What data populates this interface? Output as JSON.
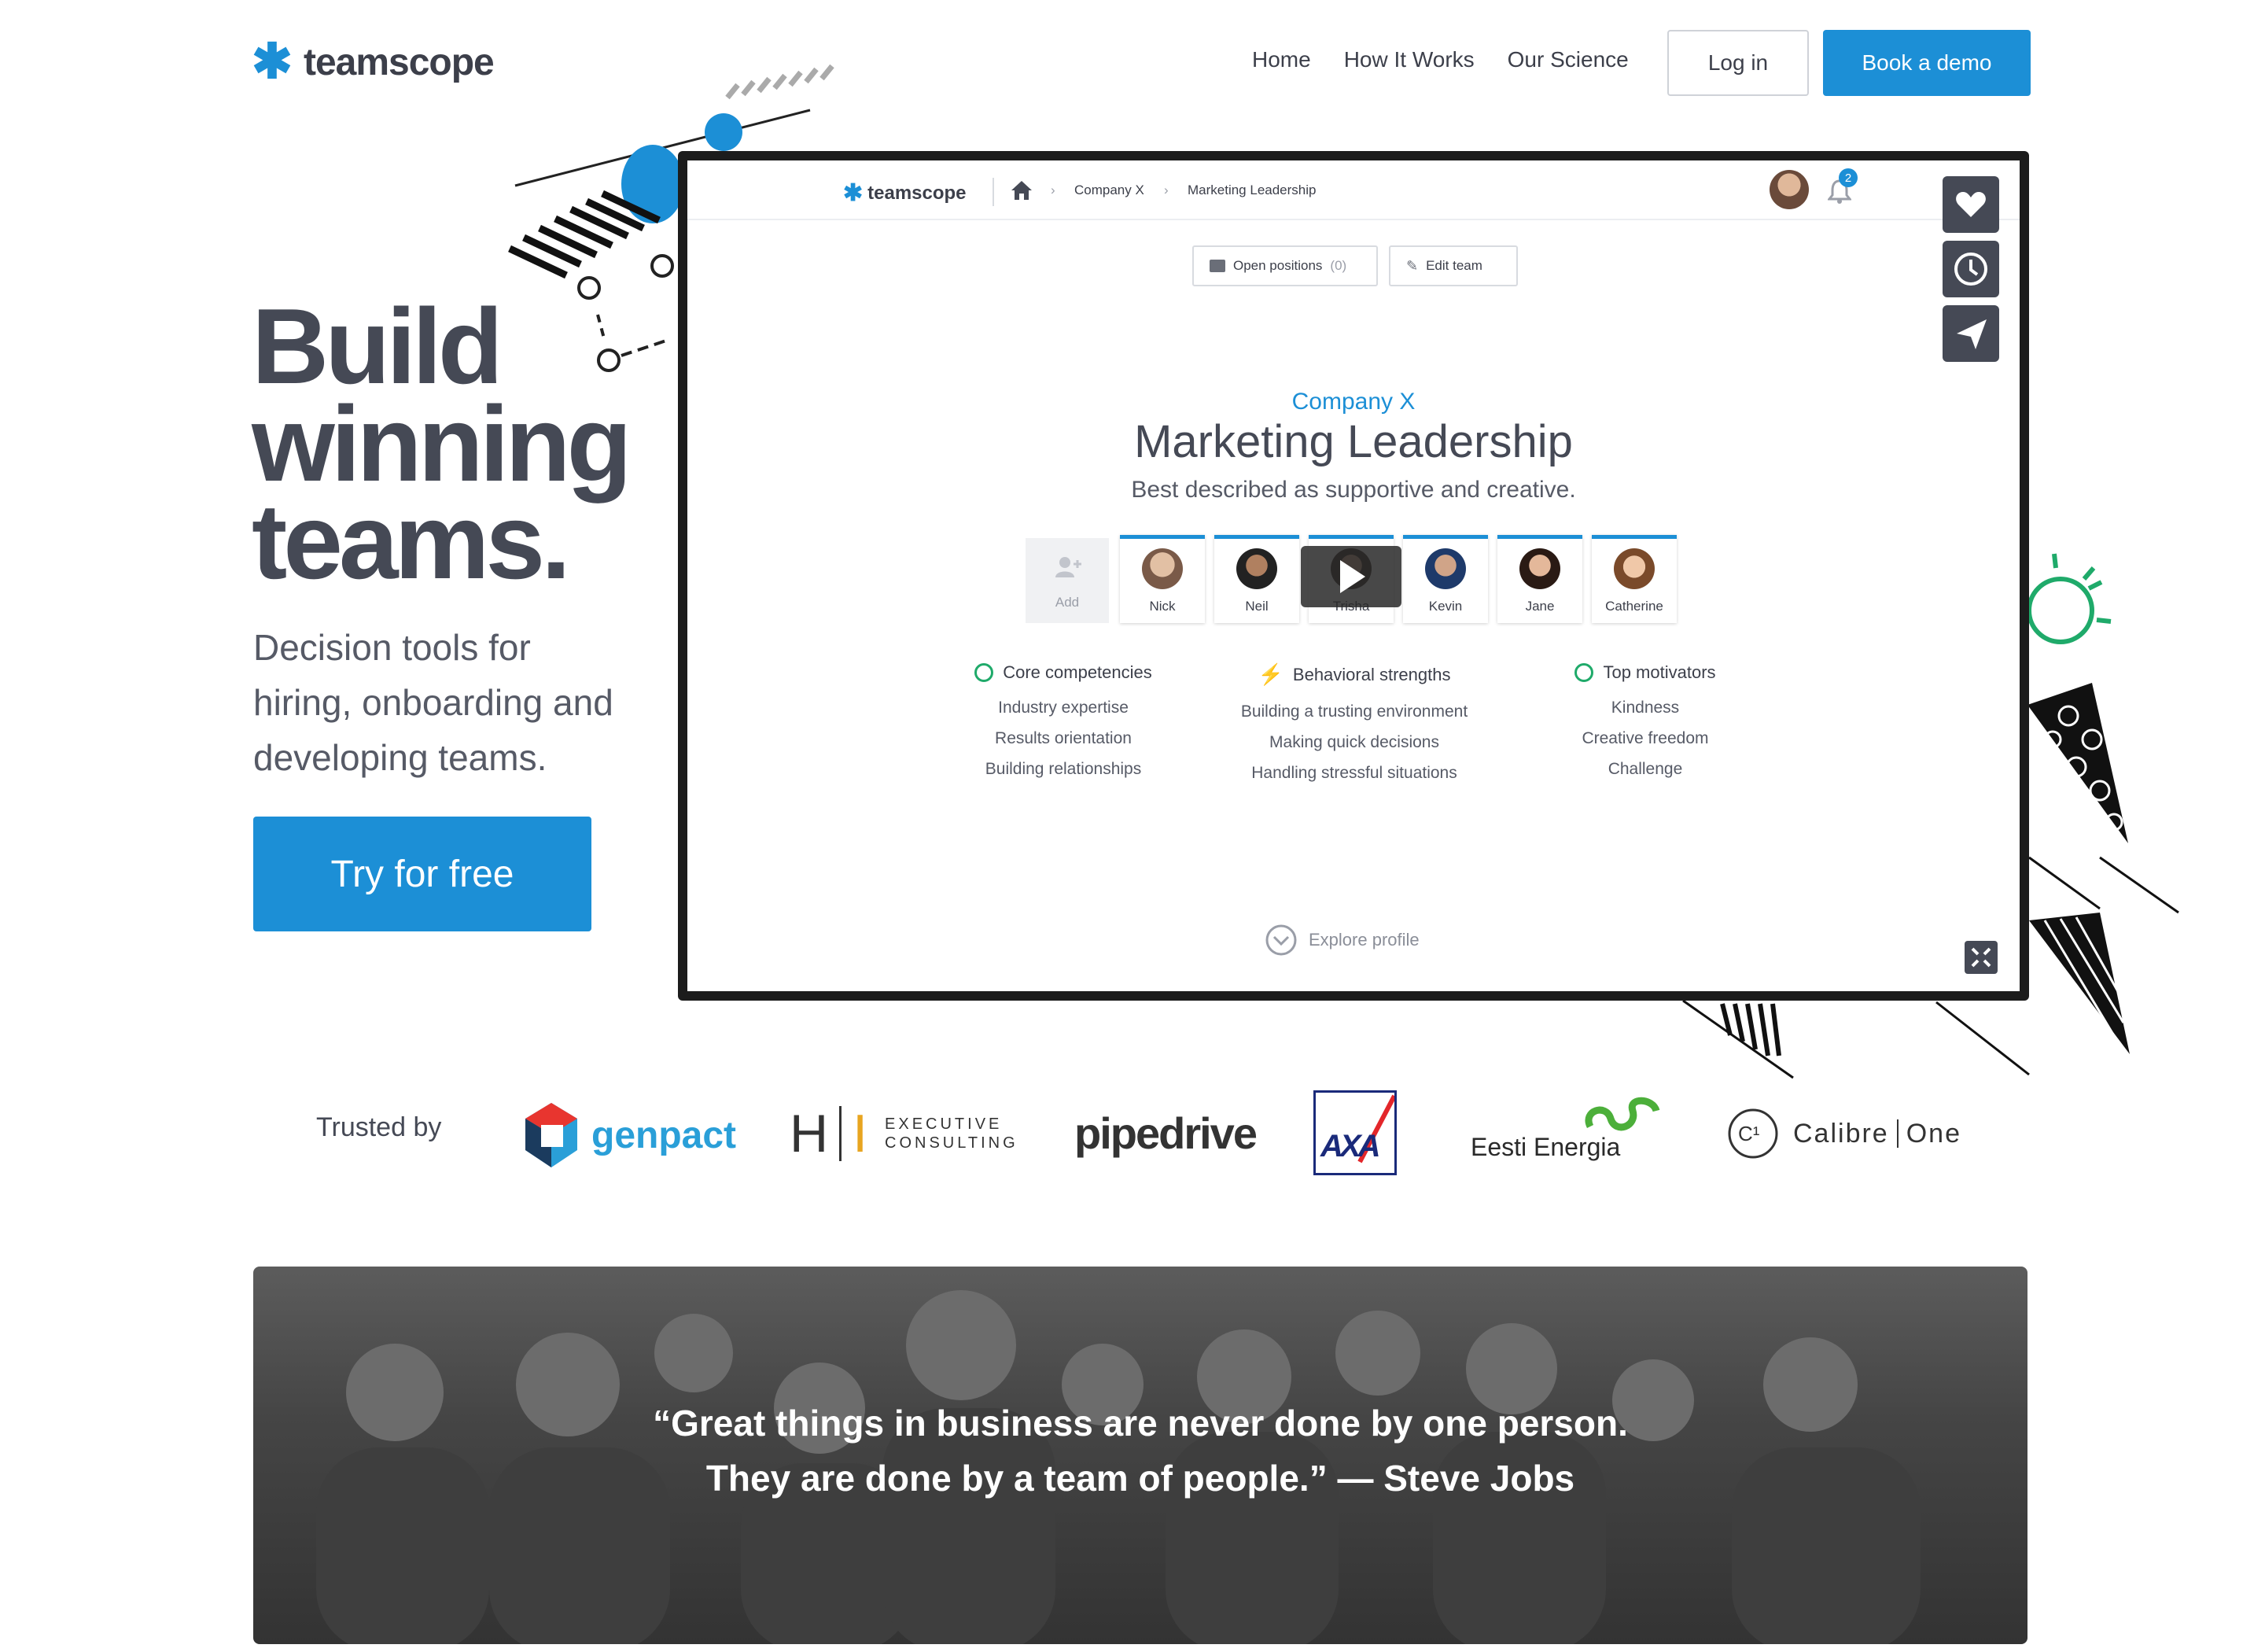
{
  "header": {
    "logo_text": "teamscope",
    "nav": [
      "Home",
      "How It Works",
      "Our Science"
    ],
    "login_label": "Log in",
    "demo_label": "Book a demo"
  },
  "hero": {
    "title_lines": [
      "Build",
      "winning",
      "teams."
    ],
    "subtitle_lines": [
      "Decision tools for",
      "hiring, onboarding and",
      "developing teams."
    ],
    "cta_label": "Try for free"
  },
  "mockup": {
    "logo_text": "teamscope",
    "breadcrumb": [
      "Company X",
      "Marketing Leadership"
    ],
    "notification_count": "2",
    "open_positions_label": "Open positions",
    "open_positions_count": "(0)",
    "edit_team_label": "Edit team",
    "company": "Company X",
    "team_title": "Marketing Leadership",
    "team_description": "Best described as supportive and creative.",
    "add_label": "Add",
    "members": [
      "Nick",
      "Neil",
      "Trisha",
      "Kevin",
      "Jane",
      "Catherine"
    ],
    "columns": [
      {
        "title": "Core competencies",
        "items": [
          "Industry expertise",
          "Results orientation",
          "Building relationships"
        ]
      },
      {
        "title": "Behavioral strengths",
        "items": [
          "Building a trusting environment",
          "Making quick decisions",
          "Handling stressful situations"
        ]
      },
      {
        "title": "Top motivators",
        "items": [
          "Kindness",
          "Creative freedom",
          "Challenge"
        ]
      }
    ],
    "explore_label": "Explore profile"
  },
  "trusted": {
    "label": "Trusted by",
    "logos": [
      "genpact",
      "H",
      "I",
      "EXECUTIVE",
      "CONSULTING",
      "pipedrive",
      "AXA",
      "Eesti Energia",
      "Calibre",
      "One"
    ]
  },
  "quote": {
    "line1": "“Great things in business are never done by one person.",
    "line2": "They are done by a team of people.” — Steve Jobs"
  },
  "colors": {
    "brand": "#1c8fd6",
    "text": "#454955",
    "green": "#1faa6a"
  }
}
